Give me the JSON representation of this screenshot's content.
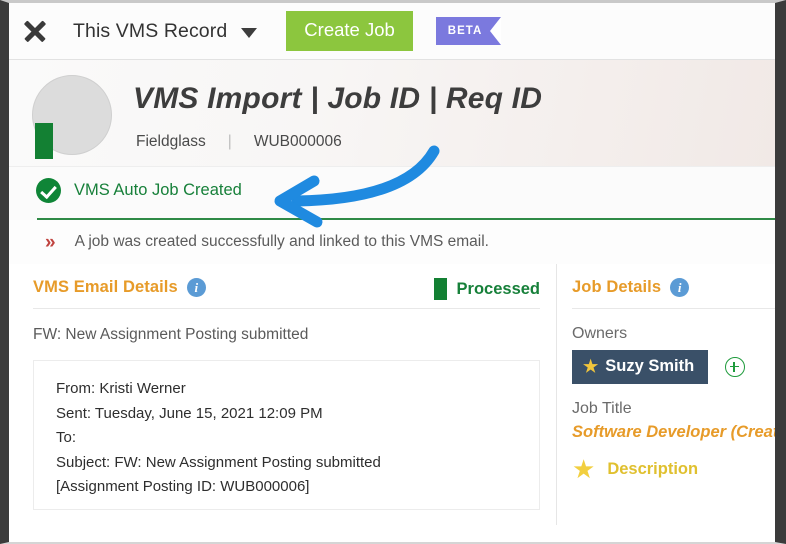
{
  "topbar": {
    "close_icon": "close-icon",
    "record_select_label": "This VMS Record",
    "caret_icon": "chevron-down-icon",
    "create_job_label": "Create Job",
    "beta_label": "BETA",
    "create_job_color": "#8cc63e",
    "beta_color": "#7b79de"
  },
  "record_header": {
    "avatar": "avatar",
    "title": "VMS Import | Job ID | Req ID",
    "source": "Fieldglass",
    "separator": "|",
    "record_id": "WUB000006"
  },
  "status": {
    "icon": "check-circle-icon",
    "text": "VMS Auto Job Created",
    "color": "#17803a"
  },
  "message": {
    "icon": "double-chevron-right-icon",
    "text": "A job was created successfully and linked to this VMS email."
  },
  "email_panel": {
    "title": "VMS Email Details",
    "info_icon": "info-icon",
    "badge_label": "Processed",
    "badge_color": "#138033",
    "subject": "FW: New Assignment Posting submitted",
    "body_lines": [
      "From: Kristi Werner",
      "Sent: Tuesday, June 15, 2021 12:09 PM",
      "To:",
      "Subject: FW: New Assignment Posting submitted",
      "[Assignment Posting ID: WUB000006]"
    ]
  },
  "job_panel": {
    "title": "Job Details",
    "info_icon": "info-icon",
    "owners_label": "Owners",
    "owner_name": "Suzy Smith",
    "owner_star_icon": "star-icon",
    "add_owner_icon": "plus-circle-icon",
    "job_title_label": "Job Title",
    "job_title_value": "Software Developer (Create",
    "description_label": "Description",
    "description_star_icon": "star-icon",
    "accent_color": "#e79b29"
  },
  "annotation": {
    "arrow_icon": "curved-arrow-annotation",
    "arrow_color": "#1f8ae0"
  }
}
